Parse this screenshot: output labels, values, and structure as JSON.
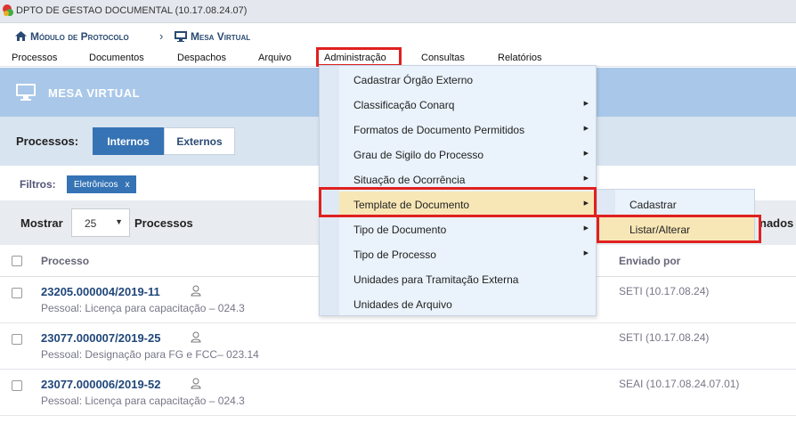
{
  "topbar": {
    "title": "DPTO DE GESTAO DOCUMENTAL (10.17.08.24.07)"
  },
  "breadcrumb": {
    "item1": "Módulo de Protocolo",
    "separator": "›",
    "item2": "Mesa Virtual"
  },
  "menu": {
    "items": [
      "Processos",
      "Documentos",
      "Despachos",
      "Arquivo",
      "Administração",
      "Consultas",
      "Relatórios"
    ],
    "active": "Administração"
  },
  "page": {
    "title": "MESA VIRTUAL"
  },
  "processos_toggle": {
    "label": "Processos:",
    "options": [
      "Internos",
      "Externos"
    ],
    "selected": "Internos"
  },
  "filters": {
    "label": "Filtros:",
    "chips": [
      {
        "label": "Eletrônicos",
        "remove": "x"
      }
    ]
  },
  "paging": {
    "show_label": "Mostrar",
    "page_size": "25",
    "suffix": "Processos",
    "trailing_partial": "nados"
  },
  "table": {
    "headers": {
      "processo": "Processo",
      "enviado_por": "Enviado por"
    },
    "rows": [
      {
        "numero": "23205.000004/2019-11",
        "descricao": "Pessoal: Licença para capacitação – 024.3",
        "enviado_por": "SETI (10.17.08.24)"
      },
      {
        "numero": "23077.000007/2019-25",
        "descricao": "Pessoal: Designação para FG e FCC– 023.14",
        "enviado_por": "SETI (10.17.08.24)"
      },
      {
        "numero": "23077.000006/2019-52",
        "descricao": "Pessoal: Licença para capacitação – 024.3",
        "enviado_por": "SEAI (10.17.08.24.07.01)"
      }
    ]
  },
  "dropdown": {
    "items": [
      {
        "label": "Cadastrar Órgão Externo",
        "has_submenu": false
      },
      {
        "label": "Classificação Conarq",
        "has_submenu": true
      },
      {
        "label": "Formatos de Documento Permitidos",
        "has_submenu": true
      },
      {
        "label": "Grau de Sigilo do Processo",
        "has_submenu": true
      },
      {
        "label": "Situação de Ocorrência",
        "has_submenu": true
      },
      {
        "label": "Template de Documento",
        "has_submenu": true,
        "highlighted": true
      },
      {
        "label": "Tipo de Documento",
        "has_submenu": true
      },
      {
        "label": "Tipo de Processo",
        "has_submenu": true
      },
      {
        "label": "Unidades para Tramitação Externa",
        "has_submenu": false
      },
      {
        "label": "Unidades de Arquivo",
        "has_submenu": false
      }
    ],
    "arrow_glyph": "▶"
  },
  "submenu": {
    "items": [
      {
        "label": "Cadastrar"
      },
      {
        "label": "Listar/Alterar",
        "highlighted": true
      }
    ]
  },
  "colors": {
    "accent": "#3573b5",
    "header_band": "#a9c7e8",
    "highlight_red": "#e02020",
    "hover": "#f8e7b6"
  },
  "icons": [
    "logo-icon",
    "home-icon",
    "monitor-icon",
    "user-icon",
    "chevron-right-icon",
    "caret-down-icon",
    "close-icon"
  ]
}
